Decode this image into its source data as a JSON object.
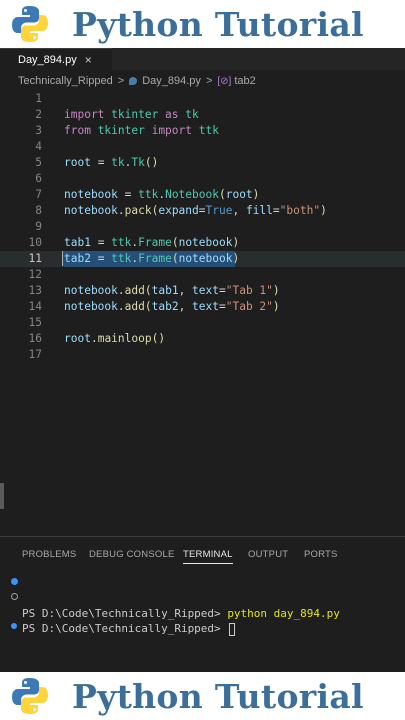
{
  "banner": {
    "title": "Python Tutorial"
  },
  "colors": {
    "banner_title": "#3b6e99",
    "python_blue": "#3d7ab5",
    "python_yellow": "#ffd43b",
    "selection": "#264f78",
    "editor_bg": "#1e1e1e"
  },
  "tab": {
    "filename": "Day_894.py",
    "close_icon": "×"
  },
  "breadcrumb": {
    "folder": "Technically_Ripped",
    "file": "Day_894.py",
    "symbol_icon": "[⊘]",
    "symbol": "tab2",
    "separator": ">"
  },
  "editor": {
    "active_line": 11,
    "line_numbers": [
      "1",
      "2",
      "3",
      "4",
      "5",
      "6",
      "7",
      "8",
      "9",
      "10",
      "11",
      "12",
      "13",
      "14",
      "15",
      "16",
      "17"
    ],
    "line2": {
      "k1": "import",
      "m": " tkinter ",
      "k2": "as",
      "a": " tk"
    },
    "line3": {
      "k1": "from",
      "m": " tkinter ",
      "k2": "import",
      "a": " ttk"
    },
    "line5": {
      "v": "root",
      "eq": " = ",
      "mod": "tk",
      "dot": ".",
      "cls": "Tk",
      "p": "()"
    },
    "line7": {
      "v": "notebook",
      "eq": " = ",
      "mod": "ttk",
      "dot": ".",
      "cls": "Notebook",
      "p1": "(",
      "arg": "root",
      "p2": ")"
    },
    "line8": {
      "v": "notebook",
      "dot": ".",
      "fn": "pack",
      "p1": "(",
      "k1": "expand",
      "eq1": "=",
      "b": "True",
      "c": ", ",
      "k2": "fill",
      "eq2": "=",
      "s": "\"both\"",
      "p2": ")"
    },
    "line10": {
      "v": "tab1",
      "eq": " = ",
      "mod": "ttk",
      "dot": ".",
      "cls": "Frame",
      "p1": "(",
      "arg": "notebook",
      "p2": ")"
    },
    "line11": {
      "v": "tab2",
      "eq": " = ",
      "mod": "ttk",
      "dot": ".",
      "cls": "Frame",
      "p1": "(",
      "arg": "notebook",
      "p2": ")"
    },
    "line13": {
      "v": "notebook",
      "dot": ".",
      "fn": "add",
      "p1": "(",
      "a1": "tab1",
      "c": ", ",
      "k": "text",
      "eq": "=",
      "s": "\"Tab 1\"",
      "p2": ")"
    },
    "line14": {
      "v": "notebook",
      "dot": ".",
      "fn": "add",
      "p1": "(",
      "a1": "tab2",
      "c": ", ",
      "k": "text",
      "eq": "=",
      "s": "\"Tab 2\"",
      "p2": ")"
    },
    "line16": {
      "v": "root",
      "dot": ".",
      "fn": "mainloop",
      "p": "()"
    }
  },
  "panel": {
    "tabs": [
      "PROBLEMS",
      "DEBUG CONSOLE",
      "TERMINAL",
      "OUTPUT",
      "PORTS"
    ],
    "active_tab": "TERMINAL",
    "terminal": {
      "line1_prompt": "PS D:\\Code\\Technically_Ripped> ",
      "line1_cmd": "python day_894.py",
      "line2_prompt": "PS D:\\Code\\Technically_Ripped> "
    }
  }
}
